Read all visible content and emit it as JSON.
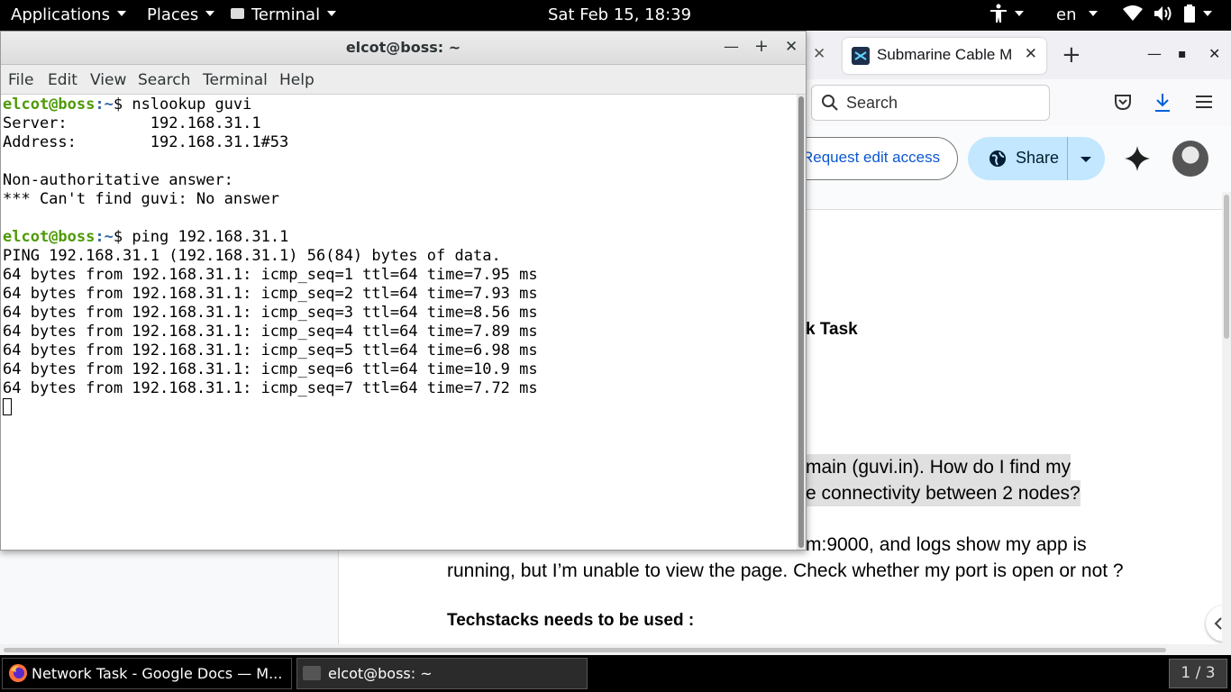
{
  "topbar": {
    "applications": "Applications",
    "places": "Places",
    "terminal": "Terminal",
    "clock": "Sat Feb 15, 18:39",
    "language": "en",
    "icons": [
      "accessibility-icon",
      "wifi-icon",
      "volume-icon",
      "battery-icon"
    ]
  },
  "browser": {
    "active_tab_title": "Submarine Cable Ma",
    "search_placeholder": "Search",
    "docs": {
      "request_edit_label": "Request edit access",
      "share_label": "Share",
      "content": {
        "heading_fragment": "k Task",
        "line1": "main (guvi.in). How do I find my",
        "line2": "e connectivity between 2 nodes?",
        "line3": "m:9000, and logs show my app is",
        "line4": "running, but I’m unable to view the page. Check whether my port is open or not ?",
        "techstack_heading": "Techstacks needs to be used :"
      }
    }
  },
  "terminal": {
    "title": "elcot@boss: ~",
    "menu": [
      "File",
      "Edit",
      "View",
      "Search",
      "Terminal",
      "Help"
    ],
    "prompt_user": "elcot@boss",
    "prompt_path": ":~",
    "commands": [
      "nslookup guvi",
      "ping 192.168.31.1"
    ],
    "nslookup_output": [
      "Server:         192.168.31.1",
      "Address:        192.168.31.1#53",
      "",
      "Non-authoritative answer:",
      "*** Can't find guvi: No answer"
    ],
    "ping_output": [
      "PING 192.168.31.1 (192.168.31.1) 56(84) bytes of data.",
      "64 bytes from 192.168.31.1: icmp_seq=1 ttl=64 time=7.95 ms",
      "64 bytes from 192.168.31.1: icmp_seq=2 ttl=64 time=7.93 ms",
      "64 bytes from 192.168.31.1: icmp_seq=3 ttl=64 time=8.56 ms",
      "64 bytes from 192.168.31.1: icmp_seq=4 ttl=64 time=7.89 ms",
      "64 bytes from 192.168.31.1: icmp_seq=5 ttl=64 time=6.98 ms",
      "64 bytes from 192.168.31.1: icmp_seq=6 ttl=64 time=10.9 ms",
      "64 bytes from 192.168.31.1: icmp_seq=7 ttl=64 time=7.72 ms"
    ]
  },
  "taskbar": {
    "tasks": [
      "Network Task - Google Docs — M...",
      "elcot@boss: ~"
    ],
    "workspace": "1 / 3"
  }
}
